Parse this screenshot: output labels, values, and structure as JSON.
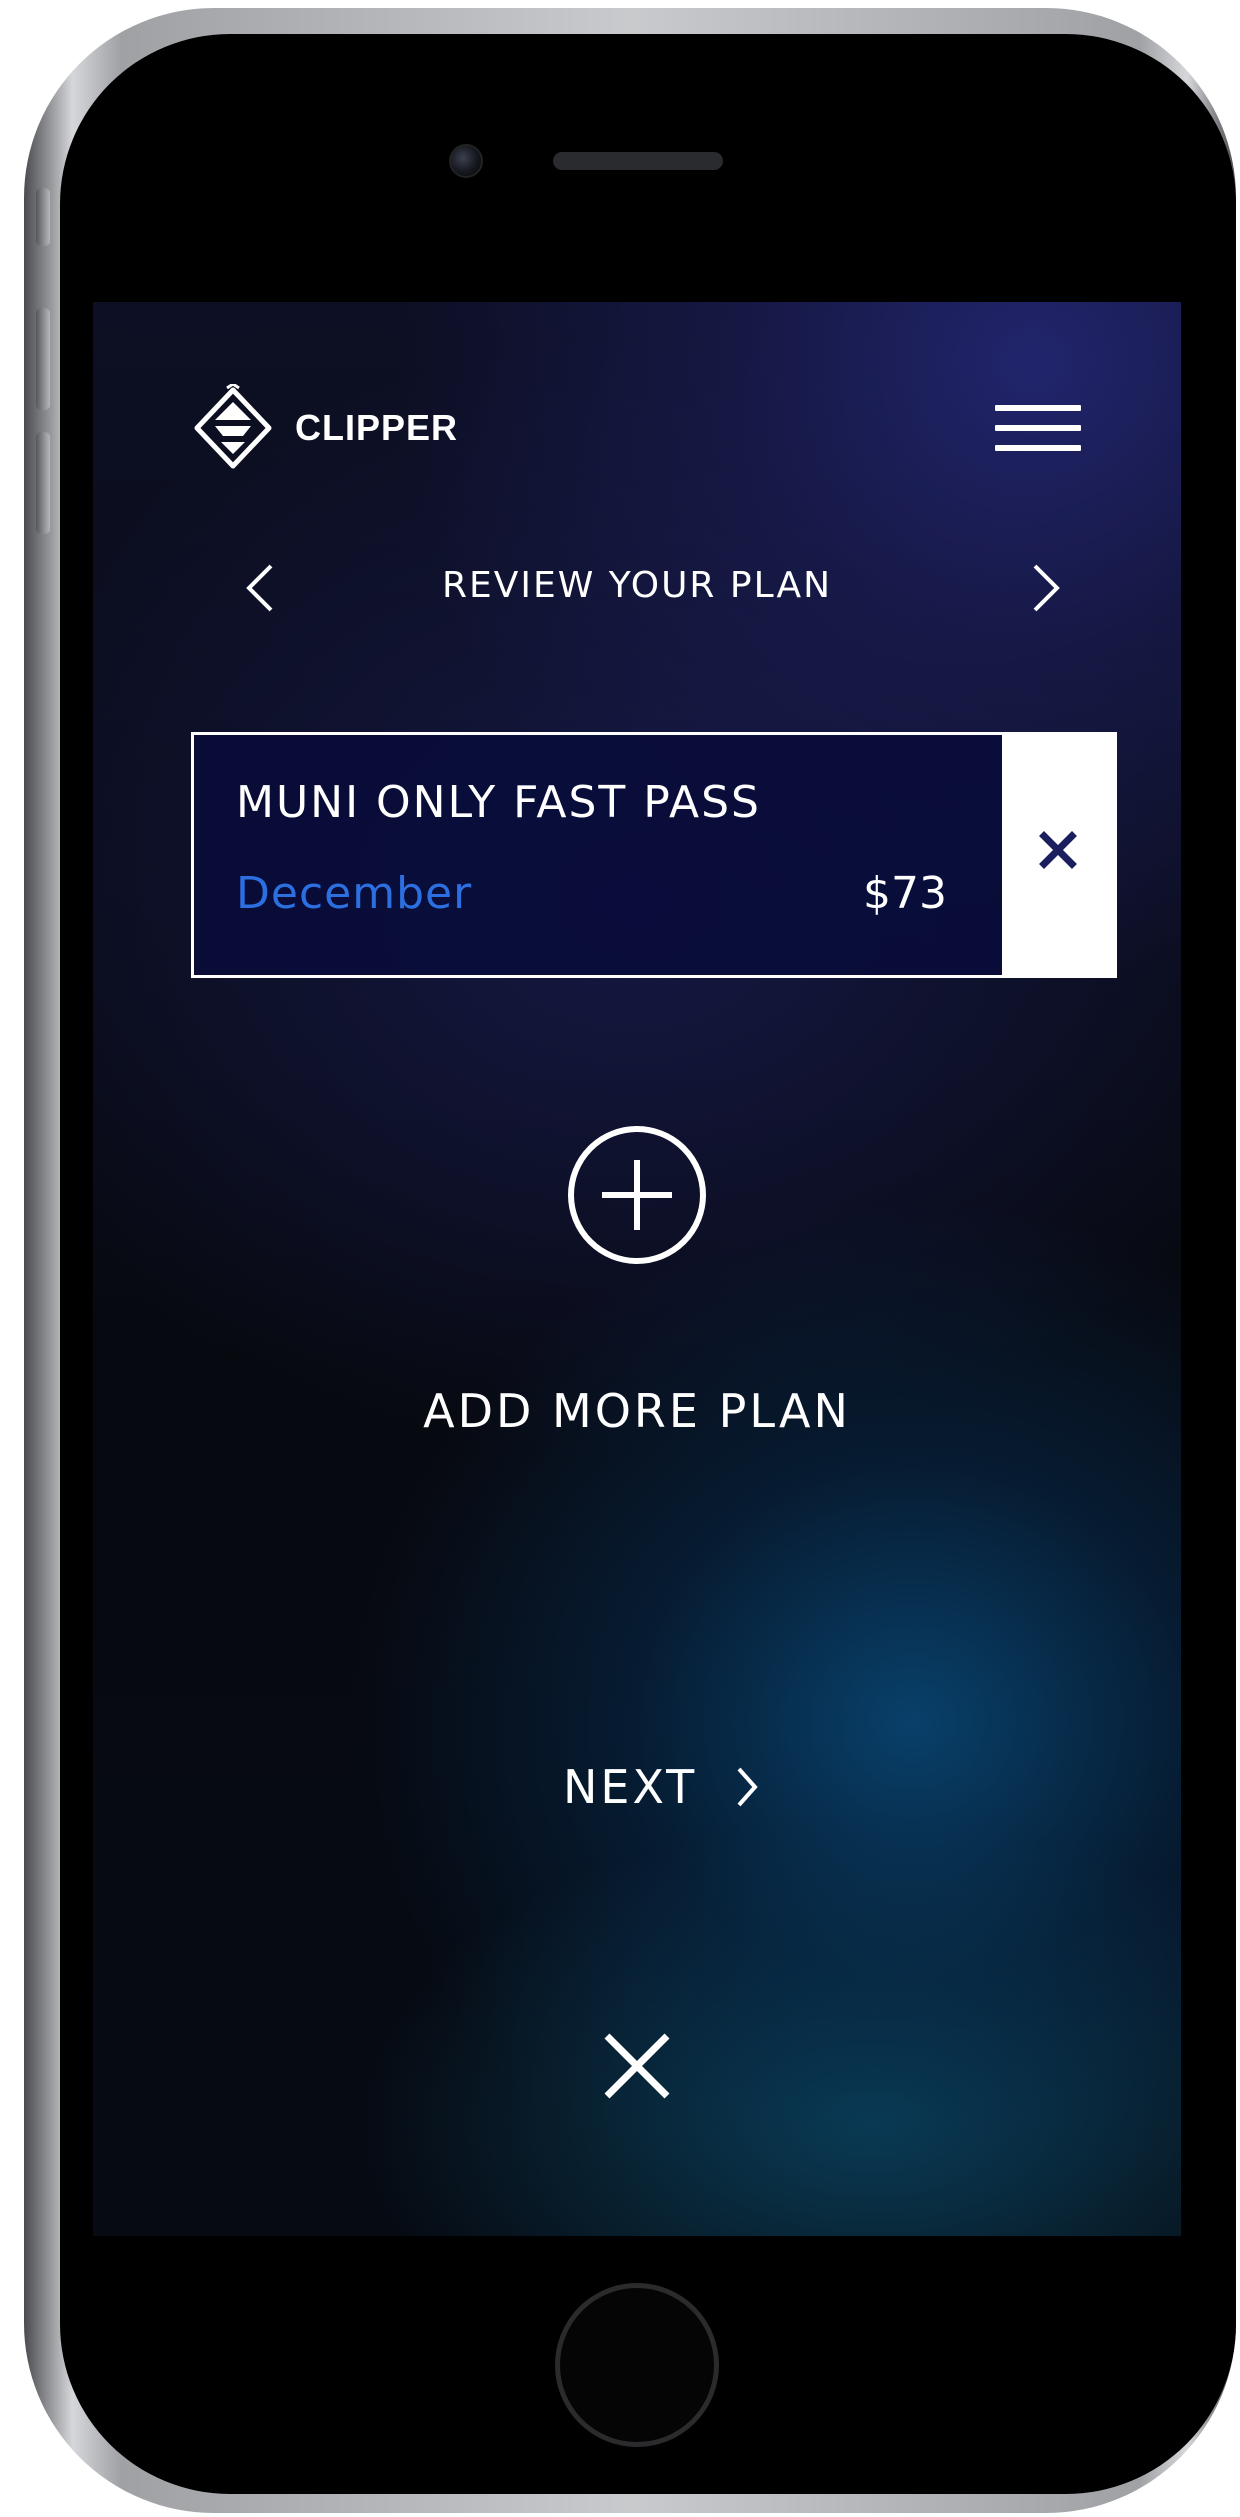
{
  "app": {
    "brand": "CLIPPER",
    "page_title": "REVIEW YOUR PLAN"
  },
  "plan_card": {
    "name": "MUNI ONLY FAST PASS",
    "month": "December",
    "price": "$73"
  },
  "add_more": {
    "label": "ADD MORE PLAN"
  },
  "next": {
    "label": "NEXT"
  },
  "icons": {
    "logo": "clipper-logo-icon",
    "menu": "hamburger-menu-icon",
    "prev": "chevron-left-icon",
    "next": "chevron-right-icon",
    "remove": "close-icon",
    "add": "plus-circle-icon",
    "close": "close-icon"
  },
  "colors": {
    "accent_blue": "#2c6fe0",
    "remove_x": "#1b1f5e",
    "text": "#ffffff"
  }
}
